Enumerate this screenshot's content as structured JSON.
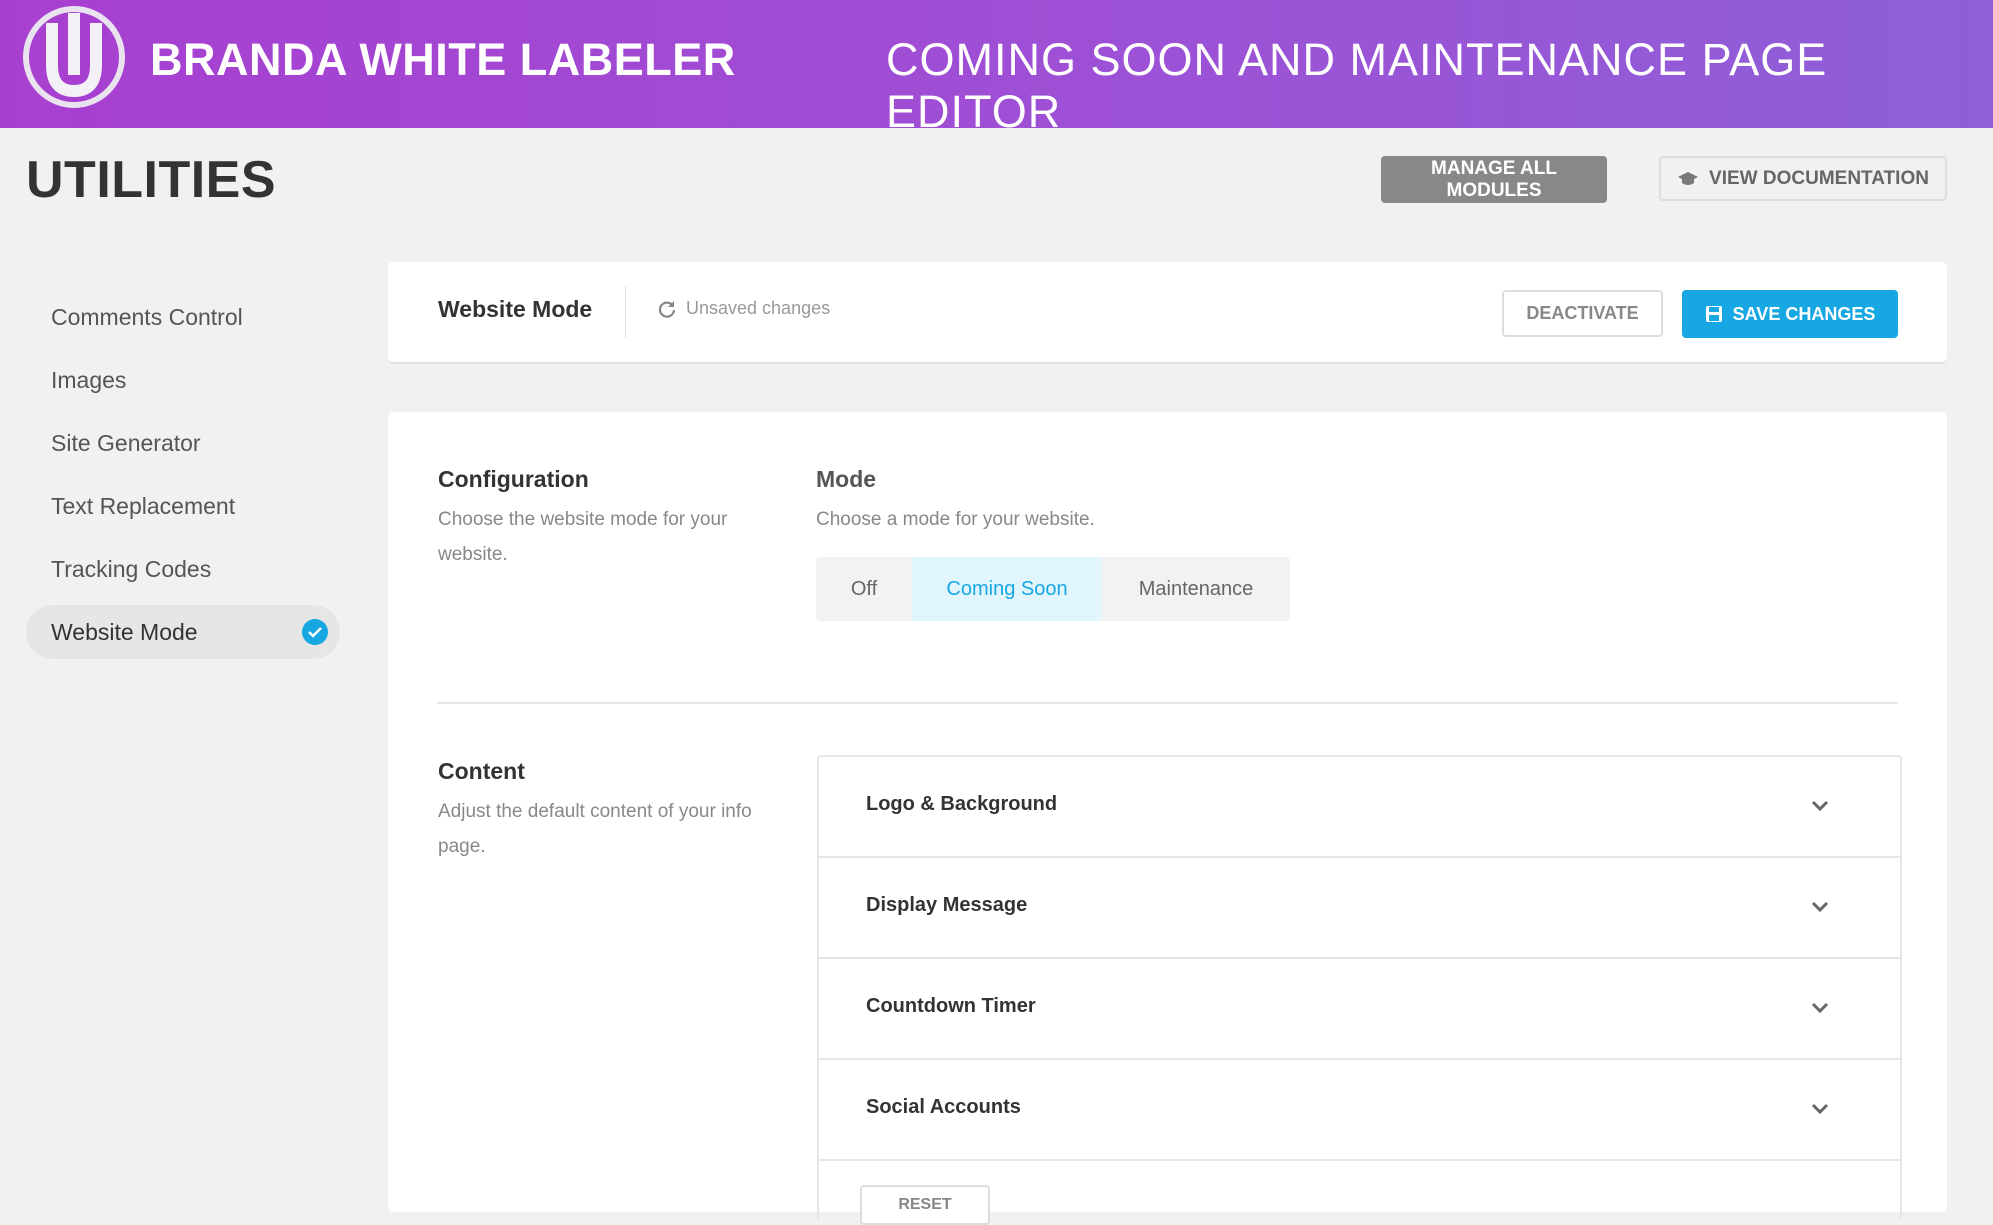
{
  "banner": {
    "brand_name": "BRANDA WHITE LABELER",
    "subtitle": "COMING SOON AND MAINTENANCE PAGE EDITOR",
    "logo_icon": "branda-logo-icon"
  },
  "header": {
    "title": "UTILITIES",
    "manage_label": "MANAGE ALL MODULES",
    "docs_label": "VIEW DOCUMENTATION",
    "docs_icon": "graduation-cap-icon"
  },
  "sidebar": {
    "items": [
      {
        "label": "Comments Control"
      },
      {
        "label": "Images"
      },
      {
        "label": "Site Generator"
      },
      {
        "label": "Text Replacement"
      },
      {
        "label": "Tracking Codes"
      },
      {
        "label": "Website Mode",
        "active": true
      }
    ]
  },
  "module_header": {
    "title": "Website Mode",
    "unsaved": "Unsaved changes",
    "deactivate_label": "DEACTIVATE",
    "save_label": "SAVE CHANGES"
  },
  "configuration": {
    "title": "Configuration",
    "description": "Choose the website mode for your website.",
    "mode_title": "Mode",
    "mode_description": "Choose a mode for your website.",
    "modes": [
      "Off",
      "Coming Soon",
      "Maintenance"
    ],
    "selected_mode": "Coming Soon"
  },
  "content": {
    "title": "Content",
    "description": "Adjust the default content of your info page.",
    "sections": [
      {
        "label": "Logo & Background"
      },
      {
        "label": "Display Message"
      },
      {
        "label": "Countdown Timer"
      },
      {
        "label": "Social Accounts"
      }
    ],
    "reset_label": "RESET"
  },
  "colors": {
    "accent": "#17a8e3",
    "banner_start": "#a83fd0",
    "banner_end": "#8e5fd8",
    "manage_button": "#888888"
  }
}
